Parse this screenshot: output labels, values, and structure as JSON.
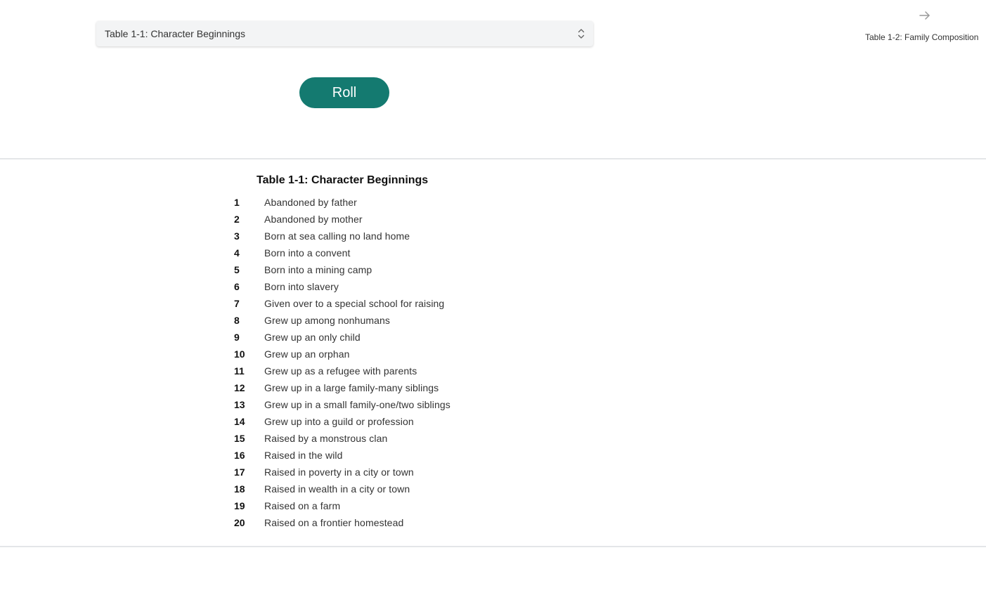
{
  "selector": {
    "value": "Table 1-1: Character Beginnings"
  },
  "next_table": {
    "label": "Table 1-2: Family Composition",
    "icon": "arrow-right-icon"
  },
  "roll_button": {
    "label": "Roll",
    "color": "#147a70"
  },
  "table": {
    "title": "Table 1-1: Character Beginnings",
    "rows": [
      {
        "num": "1",
        "text": "Abandoned by father"
      },
      {
        "num": "2",
        "text": "Abandoned by mother"
      },
      {
        "num": "3",
        "text": "Born at sea calling no land home"
      },
      {
        "num": "4",
        "text": "Born into a convent"
      },
      {
        "num": "5",
        "text": "Born into a mining camp"
      },
      {
        "num": "6",
        "text": "Born into slavery"
      },
      {
        "num": "7",
        "text": "Given over to a special school for raising"
      },
      {
        "num": "8",
        "text": "Grew up among nonhumans"
      },
      {
        "num": "9",
        "text": "Grew up an only child"
      },
      {
        "num": "10",
        "text": "Grew up an orphan"
      },
      {
        "num": "11",
        "text": "Grew up as a refugee with parents"
      },
      {
        "num": "12",
        "text": "Grew up in a large family-many siblings"
      },
      {
        "num": "13",
        "text": "Grew up in a small family-one/two siblings"
      },
      {
        "num": "14",
        "text": "Grew up into a guild or profession"
      },
      {
        "num": "15",
        "text": "Raised by a monstrous clan"
      },
      {
        "num": "16",
        "text": "Raised in the wild"
      },
      {
        "num": "17",
        "text": "Raised in poverty in a city or town"
      },
      {
        "num": "18",
        "text": "Raised in wealth in a city or town"
      },
      {
        "num": "19",
        "text": "Raised on a farm"
      },
      {
        "num": "20",
        "text": "Raised on a frontier homestead"
      }
    ]
  }
}
